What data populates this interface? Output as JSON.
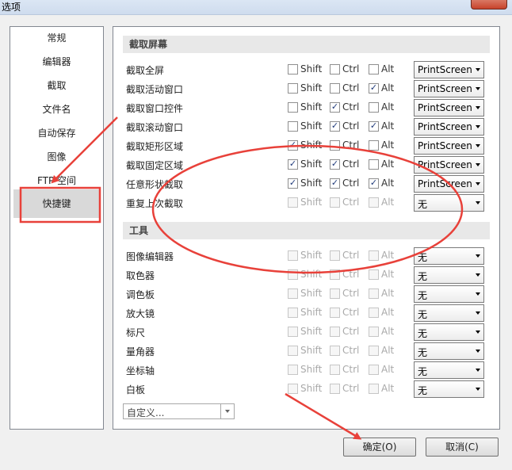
{
  "window": {
    "title": "选项"
  },
  "sidebar": {
    "items": [
      {
        "label": "常规"
      },
      {
        "label": "编辑器"
      },
      {
        "label": "截取"
      },
      {
        "label": "文件名"
      },
      {
        "label": "自动保存"
      },
      {
        "label": "图像"
      },
      {
        "label": "FTP 空间"
      },
      {
        "label": "快捷键",
        "selected": true
      }
    ]
  },
  "capture_section": {
    "title": "截取屏幕",
    "rows": [
      {
        "label": "截取全屏",
        "shift": false,
        "ctrl": false,
        "alt": false,
        "key": "PrintScreen"
      },
      {
        "label": "截取活动窗口",
        "shift": false,
        "ctrl": false,
        "alt": true,
        "key": "PrintScreen"
      },
      {
        "label": "截取窗口控件",
        "shift": false,
        "ctrl": true,
        "alt": false,
        "key": "PrintScreen"
      },
      {
        "label": "截取滚动窗口",
        "shift": false,
        "ctrl": true,
        "alt": true,
        "key": "PrintScreen"
      },
      {
        "label": "截取矩形区域",
        "shift": true,
        "ctrl": false,
        "alt": false,
        "key": "PrintScreen"
      },
      {
        "label": "截取固定区域",
        "shift": true,
        "ctrl": true,
        "alt": false,
        "key": "PrintScreen"
      },
      {
        "label": "任意形状截取",
        "shift": true,
        "ctrl": true,
        "alt": true,
        "key": "PrintScreen"
      },
      {
        "label": "重复上次截取",
        "shift": false,
        "ctrl": false,
        "alt": false,
        "key": "无",
        "disabled": true
      }
    ]
  },
  "tools_section": {
    "title": "工具",
    "rows": [
      {
        "label": "图像编辑器",
        "key": "无"
      },
      {
        "label": "取色器",
        "key": "无"
      },
      {
        "label": "调色板",
        "key": "无"
      },
      {
        "label": "放大镜",
        "key": "无"
      },
      {
        "label": "标尺",
        "key": "无"
      },
      {
        "label": "量角器",
        "key": "无"
      },
      {
        "label": "坐标轴",
        "key": "无"
      },
      {
        "label": "白板",
        "key": "无"
      }
    ]
  },
  "modifiers": {
    "shift": "Shift",
    "ctrl": "Ctrl",
    "alt": "Alt"
  },
  "custom_select": {
    "value": "自定义..."
  },
  "buttons": {
    "ok": "确定(O)",
    "cancel": "取消(C)"
  },
  "colors": {
    "annotation_red": "#e8413a",
    "selected_bg": "#d9d9d9",
    "check_mark": "#1f3a7a"
  }
}
